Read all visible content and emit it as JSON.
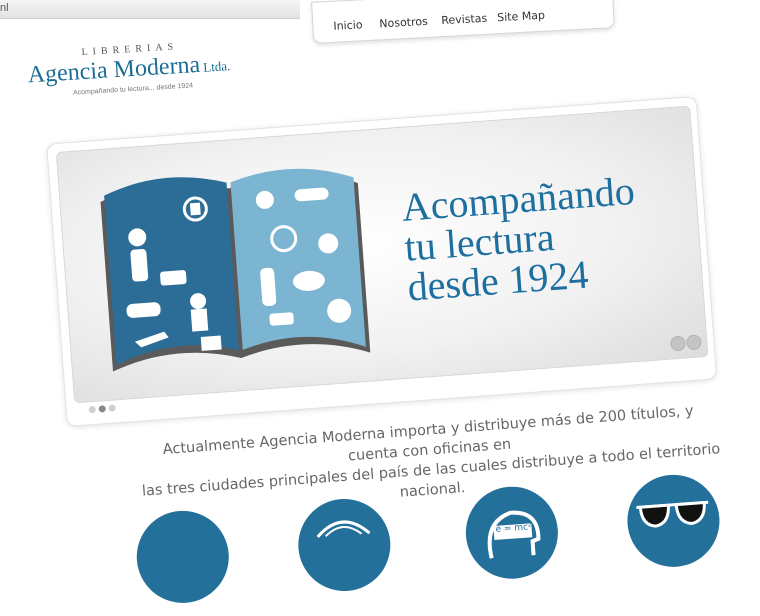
{
  "browser": {
    "url_fragment": "nl"
  },
  "nav": {
    "items": [
      "Inicio",
      "Nosotros",
      "Revistas",
      "Site Map"
    ]
  },
  "logo": {
    "top": "LIBRERIAS",
    "main": "Agencia Moderna",
    "suffix": "Ltda.",
    "tagline": "Acompañando tu lectura... desde 1924"
  },
  "banner": {
    "headline_lines": [
      "Acompañando",
      "tu lectura",
      "desde 1924"
    ],
    "slides_count": 3,
    "active_slide": 2
  },
  "intro": {
    "line1": "Actualmente Agencia Moderna importa y distribuye más de 200 títulos, y cuenta con oficinas en",
    "line2": "las tres ciudades principales del país de las cuales distribuye a todo el territorio nacional."
  },
  "category_circles": {
    "icons": [
      "circle-blank-icon",
      "shell-icon",
      "head-formula-icon",
      "sunglasses-icon"
    ],
    "formula": "e = mc²"
  },
  "colors": {
    "brand_blue": "#1d6fa0",
    "circle_blue": "#23709a",
    "book_blue": "#2b6d96",
    "book_light": "#7cb5d2"
  }
}
